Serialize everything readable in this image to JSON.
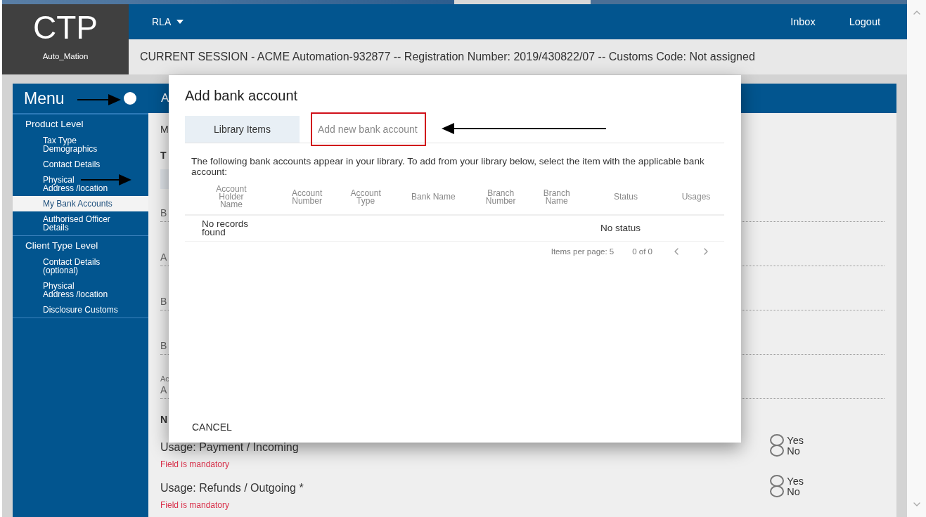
{
  "header": {
    "logo": "CTP",
    "user": "Auto_Mation",
    "nav_menu": "RLA",
    "links": [
      "Inbox",
      "Logout"
    ],
    "session": "CURRENT SESSION - ACME Automation-932877 -- Registration Number: 2019/430822/07 -- Customs Code: Not assigned"
  },
  "sidebar": {
    "title": "Menu",
    "sections": [
      {
        "label": "Product Level",
        "children": [
          {
            "label": "Tax Type\nDemographics",
            "selected": false
          },
          {
            "label": "Contact Details",
            "selected": false
          },
          {
            "label": "Physical\nAddress /location",
            "selected": false
          },
          {
            "label": "My Bank Accounts",
            "selected": true
          },
          {
            "label": "Authorised Officer\nDetails",
            "selected": false
          }
        ]
      },
      {
        "label": "Client Type Level",
        "children": [
          {
            "label": "Contact Details\n(optional)",
            "selected": false
          },
          {
            "label": "Physical\nAddress /location",
            "selected": false
          },
          {
            "label": "Disclosure Customs",
            "selected": false
          }
        ]
      }
    ]
  },
  "main": {
    "header": "A",
    "fields": [
      {
        "kind": "title",
        "text": "M"
      },
      {
        "kind": "label",
        "text": "T"
      },
      {
        "kind": "button"
      },
      {
        "kind": "input",
        "label": "B"
      },
      {
        "kind": "input",
        "label": "A"
      },
      {
        "kind": "input",
        "label": "B"
      },
      {
        "kind": "input",
        "label": "B"
      },
      {
        "kind": "input",
        "label": "Ac",
        "value": "A"
      },
      {
        "kind": "label",
        "text": "N"
      }
    ],
    "usages": [
      {
        "label": "Usage: Payment / Incoming",
        "error": "Field is mandatory",
        "options": [
          {
            "label": "Yes",
            "selected": false
          },
          {
            "label": "No",
            "selected": false
          }
        ]
      },
      {
        "label": "Usage: Refunds / Outgoing *",
        "error": "Field is mandatory",
        "options": [
          {
            "label": "Yes",
            "selected": false
          },
          {
            "label": "No",
            "selected": false
          }
        ]
      }
    ]
  },
  "dialog": {
    "title": "Add bank account",
    "tabs": [
      {
        "label": "Library Items",
        "selected": true
      },
      {
        "label": "Add new bank account",
        "selected": false,
        "highlighted": true
      }
    ],
    "intro": "The following bank accounts appear in your library. To add from your library below, select the item with the applicable bank account:",
    "table": {
      "columns": [
        "Account\nHolder\nName",
        "Account\nNumber",
        "Account\nType",
        "Bank Name",
        "Branch\nNumber",
        "Branch\nName",
        "Status",
        "Usages"
      ],
      "rows": [
        [
          "No records\nfound",
          "",
          "",
          "",
          "",
          "",
          "No status",
          ""
        ]
      ]
    },
    "pagination": {
      "items_per_page": "Items per page: 5",
      "range": "0 of 0"
    },
    "cancel": "CANCEL"
  }
}
